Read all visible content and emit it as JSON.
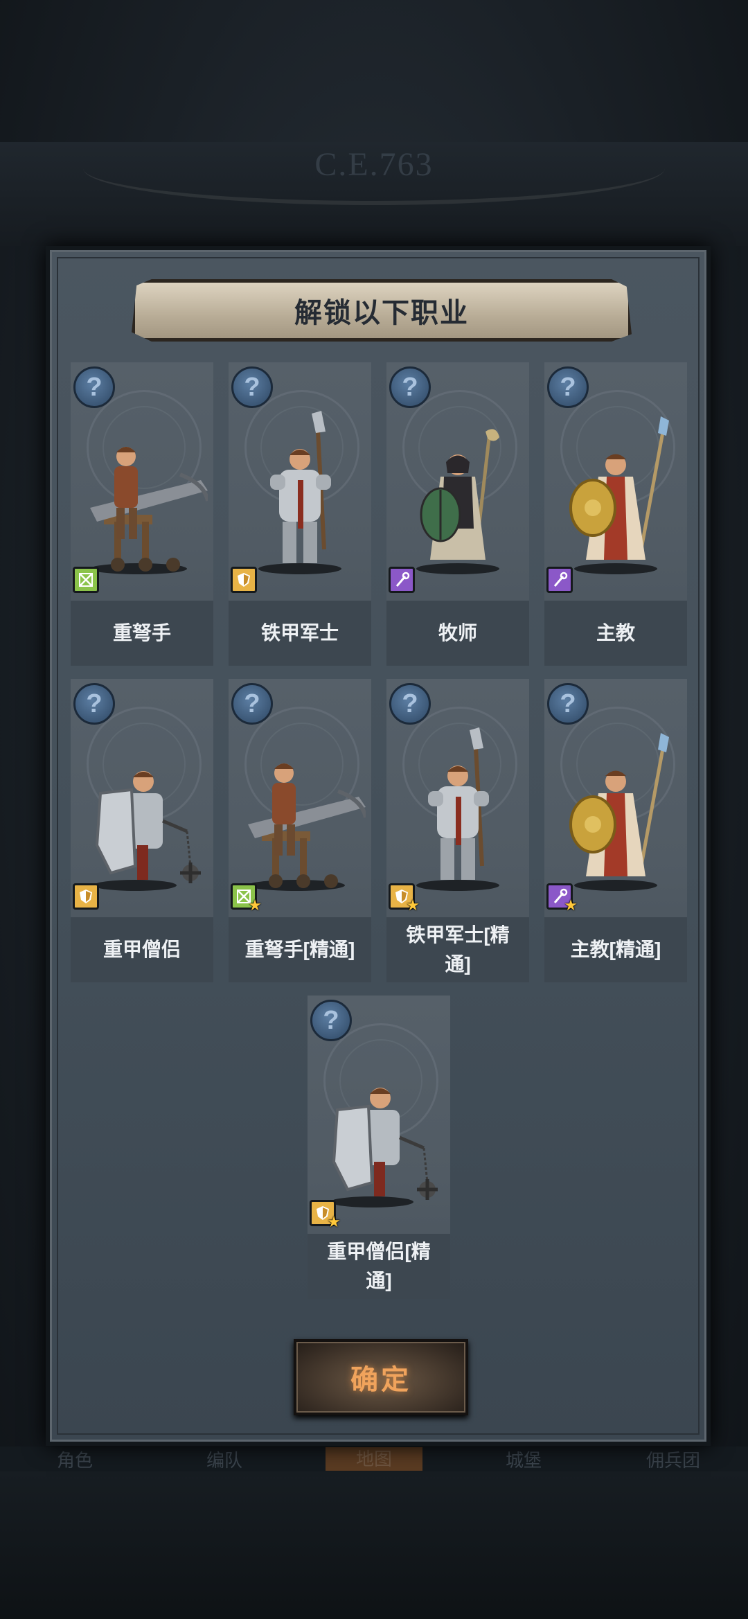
{
  "background": {
    "era_label": "C.E.763",
    "bottom_nav": [
      "角色",
      "编队",
      "地图",
      "城堡",
      "佣兵团"
    ]
  },
  "dialog": {
    "title": "解锁以下职业",
    "confirm_label": "确定",
    "cards": [
      {
        "name": "重弩手",
        "class_icon": "crossbow-icon",
        "mastered": false
      },
      {
        "name": "铁甲军士",
        "class_icon": "shield-icon",
        "mastered": false
      },
      {
        "name": "牧师",
        "class_icon": "staff-icon",
        "mastered": false
      },
      {
        "name": "主教",
        "class_icon": "staff-icon",
        "mastered": false
      },
      {
        "name": "重甲僧侣",
        "class_icon": "shield-icon",
        "mastered": false
      },
      {
        "name": "重弩手[精通]",
        "class_icon": "crossbow-icon",
        "mastered": true
      },
      {
        "name": "铁甲军士[精通]",
        "class_icon": "shield-icon",
        "mastered": true
      },
      {
        "name": "主教[精通]",
        "class_icon": "staff-icon",
        "mastered": true
      },
      {
        "name": "重甲僧侣[精通]",
        "class_icon": "shield-icon",
        "mastered": true
      }
    ],
    "help_symbol": "?",
    "star_symbol": "★"
  },
  "colors": {
    "crossbow": "#8bc34a",
    "shield": "#e8b346",
    "staff": "#8b58c8",
    "confirm_text": "#f0a35c"
  }
}
